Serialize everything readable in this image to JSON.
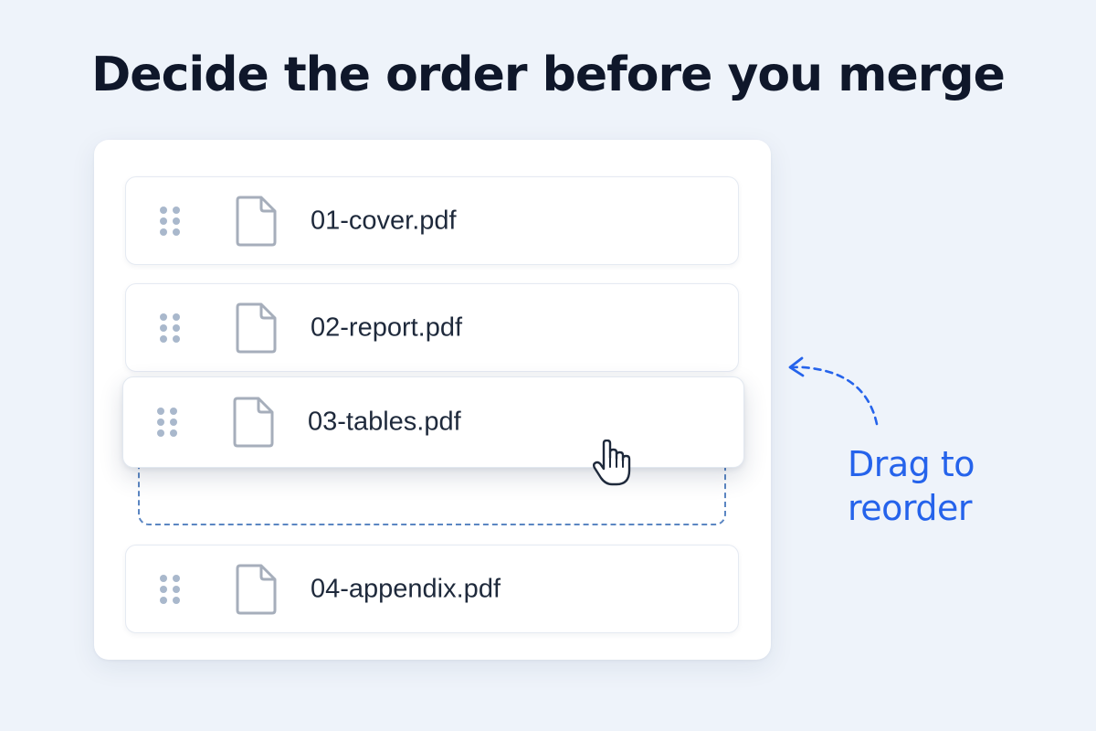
{
  "headline": "Decide the order before you merge",
  "files": [
    {
      "name": "01-cover.pdf",
      "icon": "pdf-file-icon"
    },
    {
      "name": "02-report.pdf",
      "icon": "pdf-file-icon"
    },
    {
      "name": "03-tables.pdf",
      "icon": "pdf-file-icon",
      "state": "dragging"
    },
    {
      "name": "04-appendix.pdf",
      "icon": "pdf-file-icon"
    }
  ],
  "hint": {
    "line1": "Drag to",
    "line2": "reorder"
  },
  "colors": {
    "background": "#eef3fa",
    "accent": "#2563eb",
    "text": "#0f172a",
    "drop_zone_border": "#5b86c2"
  }
}
